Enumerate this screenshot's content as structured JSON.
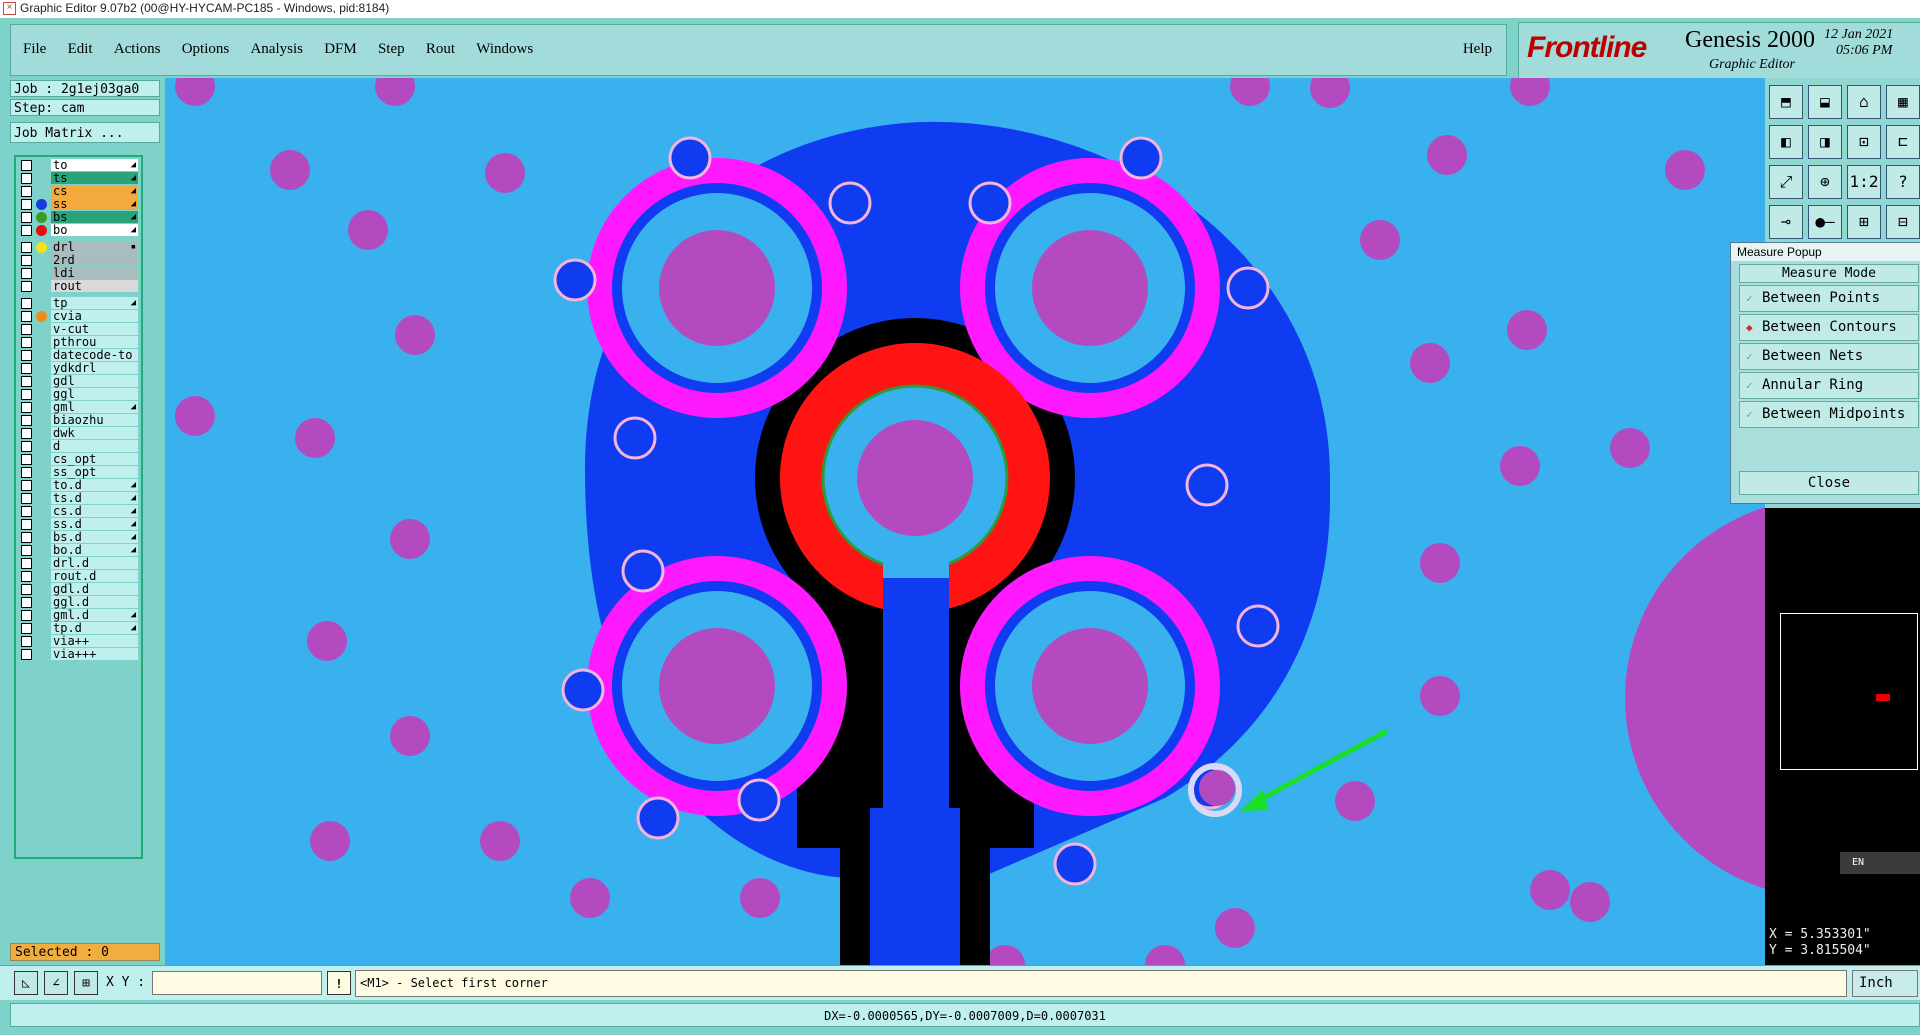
{
  "window": {
    "title": "Graphic Editor 9.07b2 (00@HY-HYCAM-PC185 - Windows, pid:8184)"
  },
  "menu": {
    "items": [
      "File",
      "Edit",
      "Actions",
      "Options",
      "Analysis",
      "DFM",
      "Step",
      "Rout",
      "Windows"
    ],
    "help": "Help"
  },
  "brand": {
    "logo": "Frontline",
    "product": "Genesis 2000",
    "subtitle": "Graphic Editor",
    "date": "12 Jan 2021",
    "time": "05:06 PM"
  },
  "job": {
    "job_label": "Job : 2g1ej03ga0",
    "step_label": "Step: cam",
    "matrix_button": "Job Matrix ..."
  },
  "layers": [
    {
      "name": "to",
      "color": "#ffffff",
      "dot": "",
      "flag": "◢"
    },
    {
      "name": "ts",
      "color": "#2aa37a",
      "dot": "",
      "flag": "◢"
    },
    {
      "name": "cs",
      "color": "#f3a93b",
      "dot": "",
      "flag": "◢"
    },
    {
      "name": "ss",
      "color": "#f3a93b",
      "dot": "#1a3ae0",
      "flag": "◢"
    },
    {
      "name": "bs",
      "color": "#2aa37a",
      "dot": "#3b9a2a",
      "flag": "◢"
    },
    {
      "name": "bo",
      "color": "#ffffff",
      "dot": "#e01010",
      "flag": "◢"
    },
    {
      "name": "drl",
      "color": "#a9bdbf",
      "dot": "#f1e21a",
      "flag": "▪"
    },
    {
      "name": "2rd",
      "color": "#a9bdbf",
      "dot": "",
      "flag": ""
    },
    {
      "name": "ldi",
      "color": "#a9bdbf",
      "dot": "",
      "flag": ""
    },
    {
      "name": "rout",
      "color": "#d9d9d9",
      "dot": "",
      "flag": ""
    },
    {
      "name": "tp",
      "color": "#bff0ee",
      "dot": "",
      "flag": "◢"
    },
    {
      "name": "cvia",
      "color": "#bff0ee",
      "dot": "#f28a20",
      "flag": ""
    },
    {
      "name": "v-cut",
      "color": "#bff0ee",
      "dot": "",
      "flag": ""
    },
    {
      "name": "pthrou",
      "color": "#bff0ee",
      "dot": "",
      "flag": ""
    },
    {
      "name": "datecode-to",
      "color": "#bff0ee",
      "dot": "",
      "flag": ""
    },
    {
      "name": "ydkdrl",
      "color": "#bff0ee",
      "dot": "",
      "flag": ""
    },
    {
      "name": "gdl",
      "color": "#bff0ee",
      "dot": "",
      "flag": ""
    },
    {
      "name": "ggl",
      "color": "#bff0ee",
      "dot": "",
      "flag": ""
    },
    {
      "name": "gml",
      "color": "#bff0ee",
      "dot": "",
      "flag": "◢"
    },
    {
      "name": "biaozhu",
      "color": "#bff0ee",
      "dot": "",
      "flag": ""
    },
    {
      "name": "dwk",
      "color": "#bff0ee",
      "dot": "",
      "flag": ""
    },
    {
      "name": "d",
      "color": "#bff0ee",
      "dot": "",
      "flag": ""
    },
    {
      "name": "cs_opt",
      "color": "#bff0ee",
      "dot": "",
      "flag": ""
    },
    {
      "name": "ss_opt",
      "color": "#bff0ee",
      "dot": "",
      "flag": ""
    },
    {
      "name": "to.d",
      "color": "#bff0ee",
      "dot": "",
      "flag": "◢"
    },
    {
      "name": "ts.d",
      "color": "#bff0ee",
      "dot": "",
      "flag": "◢"
    },
    {
      "name": "cs.d",
      "color": "#bff0ee",
      "dot": "",
      "flag": "◢"
    },
    {
      "name": "ss.d",
      "color": "#bff0ee",
      "dot": "",
      "flag": "◢"
    },
    {
      "name": "bs.d",
      "color": "#bff0ee",
      "dot": "",
      "flag": "◢"
    },
    {
      "name": "bo.d",
      "color": "#bff0ee",
      "dot": "",
      "flag": "◢"
    },
    {
      "name": "drl.d",
      "color": "#bff0ee",
      "dot": "",
      "flag": ""
    },
    {
      "name": "rout.d",
      "color": "#bff0ee",
      "dot": "",
      "flag": ""
    },
    {
      "name": "gdl.d",
      "color": "#bff0ee",
      "dot": "",
      "flag": ""
    },
    {
      "name": "ggl.d",
      "color": "#bff0ee",
      "dot": "",
      "flag": ""
    },
    {
      "name": "gml.d",
      "color": "#bff0ee",
      "dot": "",
      "flag": "◢"
    },
    {
      "name": "tp.d",
      "color": "#bff0ee",
      "dot": "",
      "flag": "◢"
    },
    {
      "name": "via++",
      "color": "#bff0ee",
      "dot": "",
      "flag": ""
    },
    {
      "name": "via+++",
      "color": "#bff0ee",
      "dot": "",
      "flag": ""
    }
  ],
  "selected": "Selected : 0",
  "measure_popup": {
    "title": "Measure Popup",
    "mode_header": "Measure Mode",
    "options": [
      {
        "label": "Between Points",
        "selected": false
      },
      {
        "label": "Between Contours",
        "selected": true
      },
      {
        "label": "Between Nets",
        "selected": false
      },
      {
        "label": "Annular Ring",
        "selected": false
      },
      {
        "label": "Between Midpoints",
        "selected": false
      }
    ],
    "close_label": "Close"
  },
  "coords": {
    "x": "X = 5.353301\"",
    "y": "Y = 3.815504\""
  },
  "bottom": {
    "xy_label": "X Y :",
    "xy_value": "",
    "excl": "!",
    "prompt": "<M1> - Select first corner",
    "units": "Inch"
  },
  "status": "DX=-0.0000565,DY=-0.0007009,D=0.0007031",
  "tray": {
    "lang": "EN"
  },
  "toolbar_icons": [
    "zoom-home-icon",
    "zoom-in-icon",
    "house-icon",
    "window-icon",
    "pan-left-icon",
    "pan-right-icon",
    "zoom-1-1-icon",
    "snap-icon",
    "fit-icon",
    "center-icon",
    "ratio-icon",
    "help-icon",
    "route-icon",
    "measure-icon",
    "net-icon",
    "layers-icon"
  ],
  "toolbar_glyphs": [
    "⬒",
    "⬓",
    "⌂",
    "▦",
    "◧",
    "◨",
    "⊡",
    "⊏",
    "⤢",
    "⊕",
    "1:2",
    "?",
    "⊸",
    "●–",
    "⊞",
    "⊟"
  ],
  "colors": {
    "background": "#39b1ee",
    "copper": "#0f3cf0",
    "pad": "#b44ac0",
    "mask": "#ff19ff",
    "red": "#ff1313",
    "black": "#000000",
    "arrow": "#18e028"
  }
}
